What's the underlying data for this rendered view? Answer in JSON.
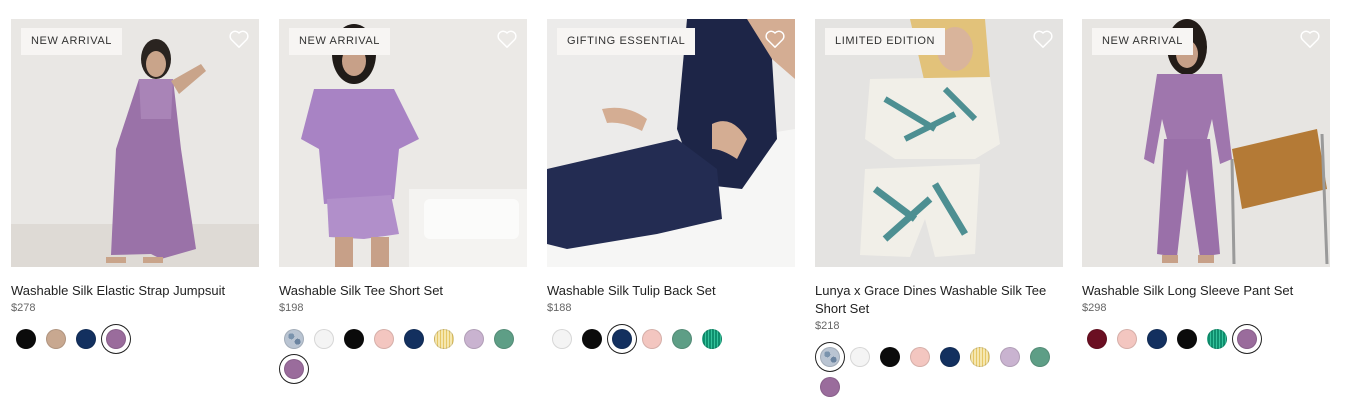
{
  "products": [
    {
      "badge": "NEW ARRIVAL",
      "name": "Washable Silk Elastic Strap Jumpsuit",
      "price": "$278",
      "swatches": [
        {
          "color": "#0b0b0b",
          "selected": false
        },
        {
          "color": "#c8a890",
          "selected": false
        },
        {
          "color": "#13305f",
          "selected": false
        },
        {
          "color": "#9a6c9c",
          "selected": true
        }
      ]
    },
    {
      "badge": "NEW ARRIVAL",
      "name": "Washable Silk Tee Short Set",
      "price": "$198",
      "swatches": [
        {
          "color": "#b9c4d2",
          "pattern": "print",
          "selected": false
        },
        {
          "color": "#f4f4f4",
          "selected": false
        },
        {
          "color": "#0b0b0b",
          "selected": false
        },
        {
          "color": "#f3c6c0",
          "selected": false
        },
        {
          "color": "#13305f",
          "selected": false
        },
        {
          "color": "#f5e7b0",
          "pattern": "stripe",
          "selected": false
        },
        {
          "color": "#c9b3d0",
          "selected": false
        },
        {
          "color": "#5e9e86",
          "selected": false
        },
        {
          "color": "#9a6c9c",
          "selected": true
        }
      ]
    },
    {
      "badge": "GIFTING ESSENTIAL",
      "name": "Washable Silk Tulip Back Set",
      "price": "$188",
      "swatches": [
        {
          "color": "#f4f4f4",
          "selected": false
        },
        {
          "color": "#0b0b0b",
          "selected": false
        },
        {
          "color": "#13305f",
          "selected": true
        },
        {
          "color": "#f3c6c0",
          "selected": false
        },
        {
          "color": "#5e9e86",
          "selected": false
        },
        {
          "color": "#0f8f6e",
          "pattern": "stripe-green",
          "selected": false
        }
      ]
    },
    {
      "badge": "LIMITED EDITION",
      "name": "Lunya x Grace Dines Washable Silk Tee Short Set",
      "price": "$218",
      "swatches": [
        {
          "color": "#b9c4d2",
          "pattern": "print",
          "selected": true
        },
        {
          "color": "#f4f4f4",
          "selected": false
        },
        {
          "color": "#0b0b0b",
          "selected": false
        },
        {
          "color": "#f3c6c0",
          "selected": false
        },
        {
          "color": "#13305f",
          "selected": false
        },
        {
          "color": "#f5e7b0",
          "pattern": "stripe",
          "selected": false
        },
        {
          "color": "#c9b3d0",
          "selected": false
        },
        {
          "color": "#5e9e86",
          "selected": false
        },
        {
          "color": "#9a6c9c",
          "selected": false
        }
      ]
    },
    {
      "badge": "NEW ARRIVAL",
      "name": "Washable Silk Long Sleeve Pant Set",
      "price": "$298",
      "swatches": [
        {
          "color": "#6b0f22",
          "selected": false
        },
        {
          "color": "#f3c6c0",
          "selected": false
        },
        {
          "color": "#13305f",
          "selected": false
        },
        {
          "color": "#0b0b0b",
          "selected": false
        },
        {
          "color": "#0f8f6e",
          "pattern": "stripe-green",
          "selected": false
        },
        {
          "color": "#9a6c9c",
          "selected": true
        }
      ]
    }
  ]
}
